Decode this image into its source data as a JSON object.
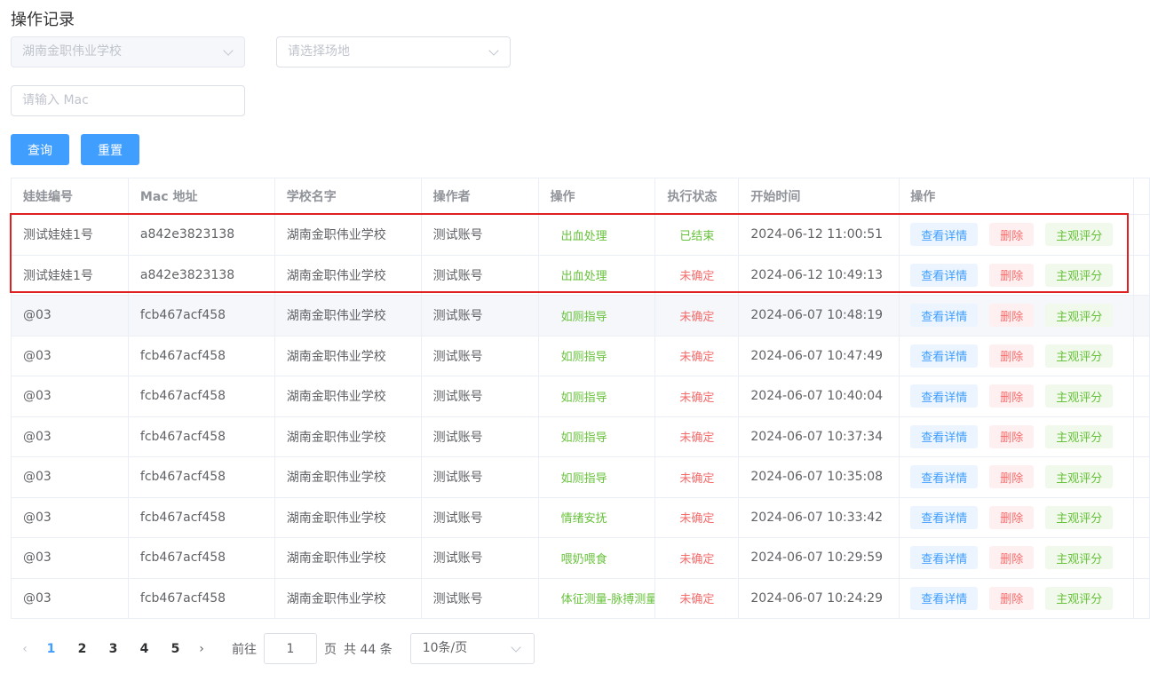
{
  "page": {
    "title": "操作记录"
  },
  "filters": {
    "school_select": "湖南金职伟业学校",
    "venue_placeholder": "请选择场地",
    "mac_placeholder": "请输入 Mac",
    "query_label": "查询",
    "reset_label": "重置"
  },
  "table": {
    "headers": [
      "娃娃编号",
      "Mac 地址",
      "学校名字",
      "操作者",
      "操作",
      "执行状态",
      "开始时间",
      "操作"
    ],
    "actions": {
      "view": "查看详情",
      "delete": "删除",
      "score": "主观评分"
    },
    "rows": [
      {
        "doll": "测试娃娃1号",
        "mac": "a842e3823138",
        "school": "湖南金职伟业学校",
        "operator": "测试账号",
        "op": "出血处理",
        "status": "已结束",
        "time": "2024-06-12 11:00:51"
      },
      {
        "doll": "测试娃娃1号",
        "mac": "a842e3823138",
        "school": "湖南金职伟业学校",
        "operator": "测试账号",
        "op": "出血处理",
        "status": "未确定",
        "time": "2024-06-12 10:49:13"
      },
      {
        "doll": "@03",
        "mac": "fcb467acf458",
        "school": "湖南金职伟业学校",
        "operator": "测试账号",
        "op": "如厕指导",
        "status": "未确定",
        "time": "2024-06-07 10:48:19"
      },
      {
        "doll": "@03",
        "mac": "fcb467acf458",
        "school": "湖南金职伟业学校",
        "operator": "测试账号",
        "op": "如厕指导",
        "status": "未确定",
        "time": "2024-06-07 10:47:49"
      },
      {
        "doll": "@03",
        "mac": "fcb467acf458",
        "school": "湖南金职伟业学校",
        "operator": "测试账号",
        "op": "如厕指导",
        "status": "未确定",
        "time": "2024-06-07 10:40:04"
      },
      {
        "doll": "@03",
        "mac": "fcb467acf458",
        "school": "湖南金职伟业学校",
        "operator": "测试账号",
        "op": "如厕指导",
        "status": "未确定",
        "time": "2024-06-07 10:37:34"
      },
      {
        "doll": "@03",
        "mac": "fcb467acf458",
        "school": "湖南金职伟业学校",
        "operator": "测试账号",
        "op": "如厕指导",
        "status": "未确定",
        "time": "2024-06-07 10:35:08"
      },
      {
        "doll": "@03",
        "mac": "fcb467acf458",
        "school": "湖南金职伟业学校",
        "operator": "测试账号",
        "op": "情绪安抚",
        "status": "未确定",
        "time": "2024-06-07 10:33:42"
      },
      {
        "doll": "@03",
        "mac": "fcb467acf458",
        "school": "湖南金职伟业学校",
        "operator": "测试账号",
        "op": "喂奶喂食",
        "status": "未确定",
        "time": "2024-06-07 10:29:59"
      },
      {
        "doll": "@03",
        "mac": "fcb467acf458",
        "school": "湖南金职伟业学校",
        "operator": "测试账号",
        "op": "体征测量-脉搏测量",
        "status": "未确定",
        "time": "2024-06-07 10:24:29"
      }
    ]
  },
  "pagination": {
    "pages": [
      "1",
      "2",
      "3",
      "4",
      "5"
    ],
    "current": "1",
    "prev_icon": "chevron-left-icon",
    "next_icon": "chevron-right-icon",
    "goto_label": "前往",
    "page_input": "1",
    "page_suffix": "页",
    "total_label": "共 44 条",
    "page_size": "10条/页"
  },
  "colors": {
    "primary": "#409eff",
    "success": "#67c23a",
    "danger": "#f56c6c",
    "highlight_box": "#e02020"
  }
}
